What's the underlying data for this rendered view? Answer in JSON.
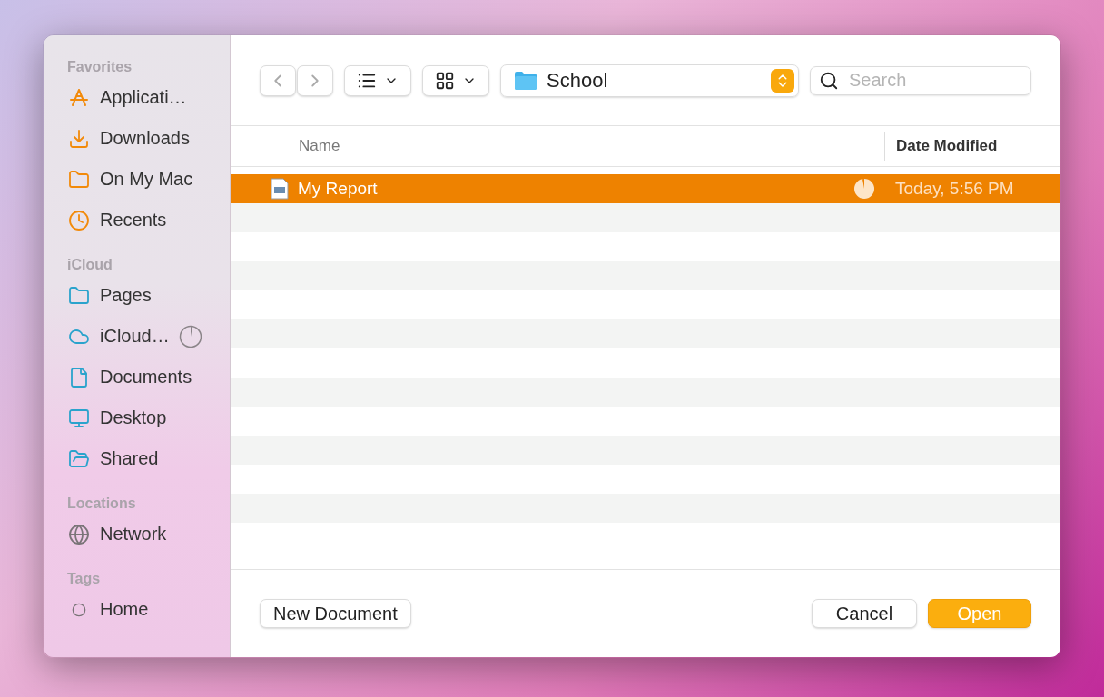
{
  "sidebar": {
    "sections": [
      {
        "title": "Favorites",
        "items": [
          {
            "label": "Applicati…",
            "syncing": false
          },
          {
            "label": "Downloads",
            "syncing": false
          },
          {
            "label": "On My Mac",
            "syncing": false
          },
          {
            "label": "Recents",
            "syncing": false
          }
        ]
      },
      {
        "title": "iCloud",
        "items": [
          {
            "label": "Pages",
            "syncing": false
          },
          {
            "label": "iCloud…",
            "syncing": true
          },
          {
            "label": "Documents",
            "syncing": false
          },
          {
            "label": "Desktop",
            "syncing": false
          },
          {
            "label": "Shared",
            "syncing": false
          }
        ]
      },
      {
        "title": "Locations",
        "items": [
          {
            "label": "Network",
            "syncing": false
          }
        ]
      },
      {
        "title": "Tags",
        "items": [
          {
            "label": "Home",
            "syncing": false
          }
        ]
      }
    ]
  },
  "toolbar": {
    "location": "School",
    "search": {
      "placeholder": "Search"
    }
  },
  "table": {
    "columns": [
      "Name",
      "Date Modified"
    ],
    "rows": [
      {
        "name": "My Report",
        "date": "Today, 5:56 PM",
        "selected": true,
        "syncing": true
      }
    ]
  },
  "buttons": {
    "left": "New Document",
    "cancel": "Cancel",
    "open": "Open"
  }
}
